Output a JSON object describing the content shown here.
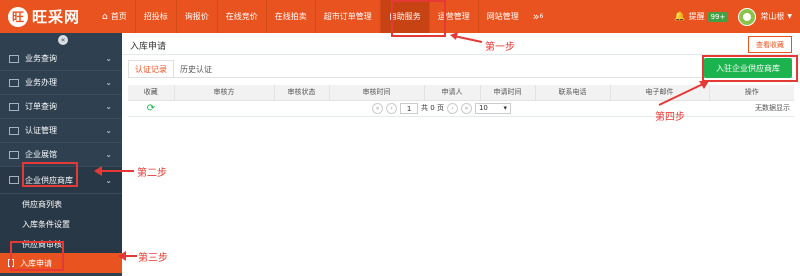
{
  "app": {
    "logo_char": "旺",
    "logo_text": "旺采网"
  },
  "nav": {
    "home": "首页",
    "items": [
      "招投标",
      "询报价",
      "在线竞价",
      "在线拍卖",
      "超市订单管理",
      "自助服务",
      "运营管理",
      "网站管理"
    ],
    "more": "»",
    "more_sup": "6"
  },
  "user": {
    "remind": "提醒",
    "badge": "99+",
    "name": "常山根"
  },
  "sidebar": {
    "toggle": "«",
    "items": [
      "业务查询",
      "业务办理",
      "订单查询",
      "认证管理",
      "企业展馆",
      "企业供应商库"
    ],
    "sub_items": [
      "供应商列表",
      "入库条件设置",
      "供应商审核",
      "入库申请"
    ]
  },
  "main": {
    "title": "入库申请",
    "btn_view": "查看收藏",
    "tabs": [
      "认证记录",
      "历史认证"
    ],
    "btn_apply": "入驻企业供应商库",
    "columns": [
      "收藏",
      "审核方",
      "审核状态",
      "审核时间",
      "申请人",
      "申请时间",
      "联系电话",
      "电子邮件",
      "操作"
    ],
    "pager": {
      "page": "1",
      "total": "共 0 页",
      "size": "10"
    },
    "nodata": "无数据显示"
  },
  "annotations": {
    "step1": "第一步",
    "step2": "第二步",
    "step3": "第三步",
    "step4": "第四步"
  },
  "colors": {
    "brand": "#e8531f",
    "sidebar": "#2f4050",
    "green": "#1ab34d",
    "annotation": "#e53935"
  }
}
